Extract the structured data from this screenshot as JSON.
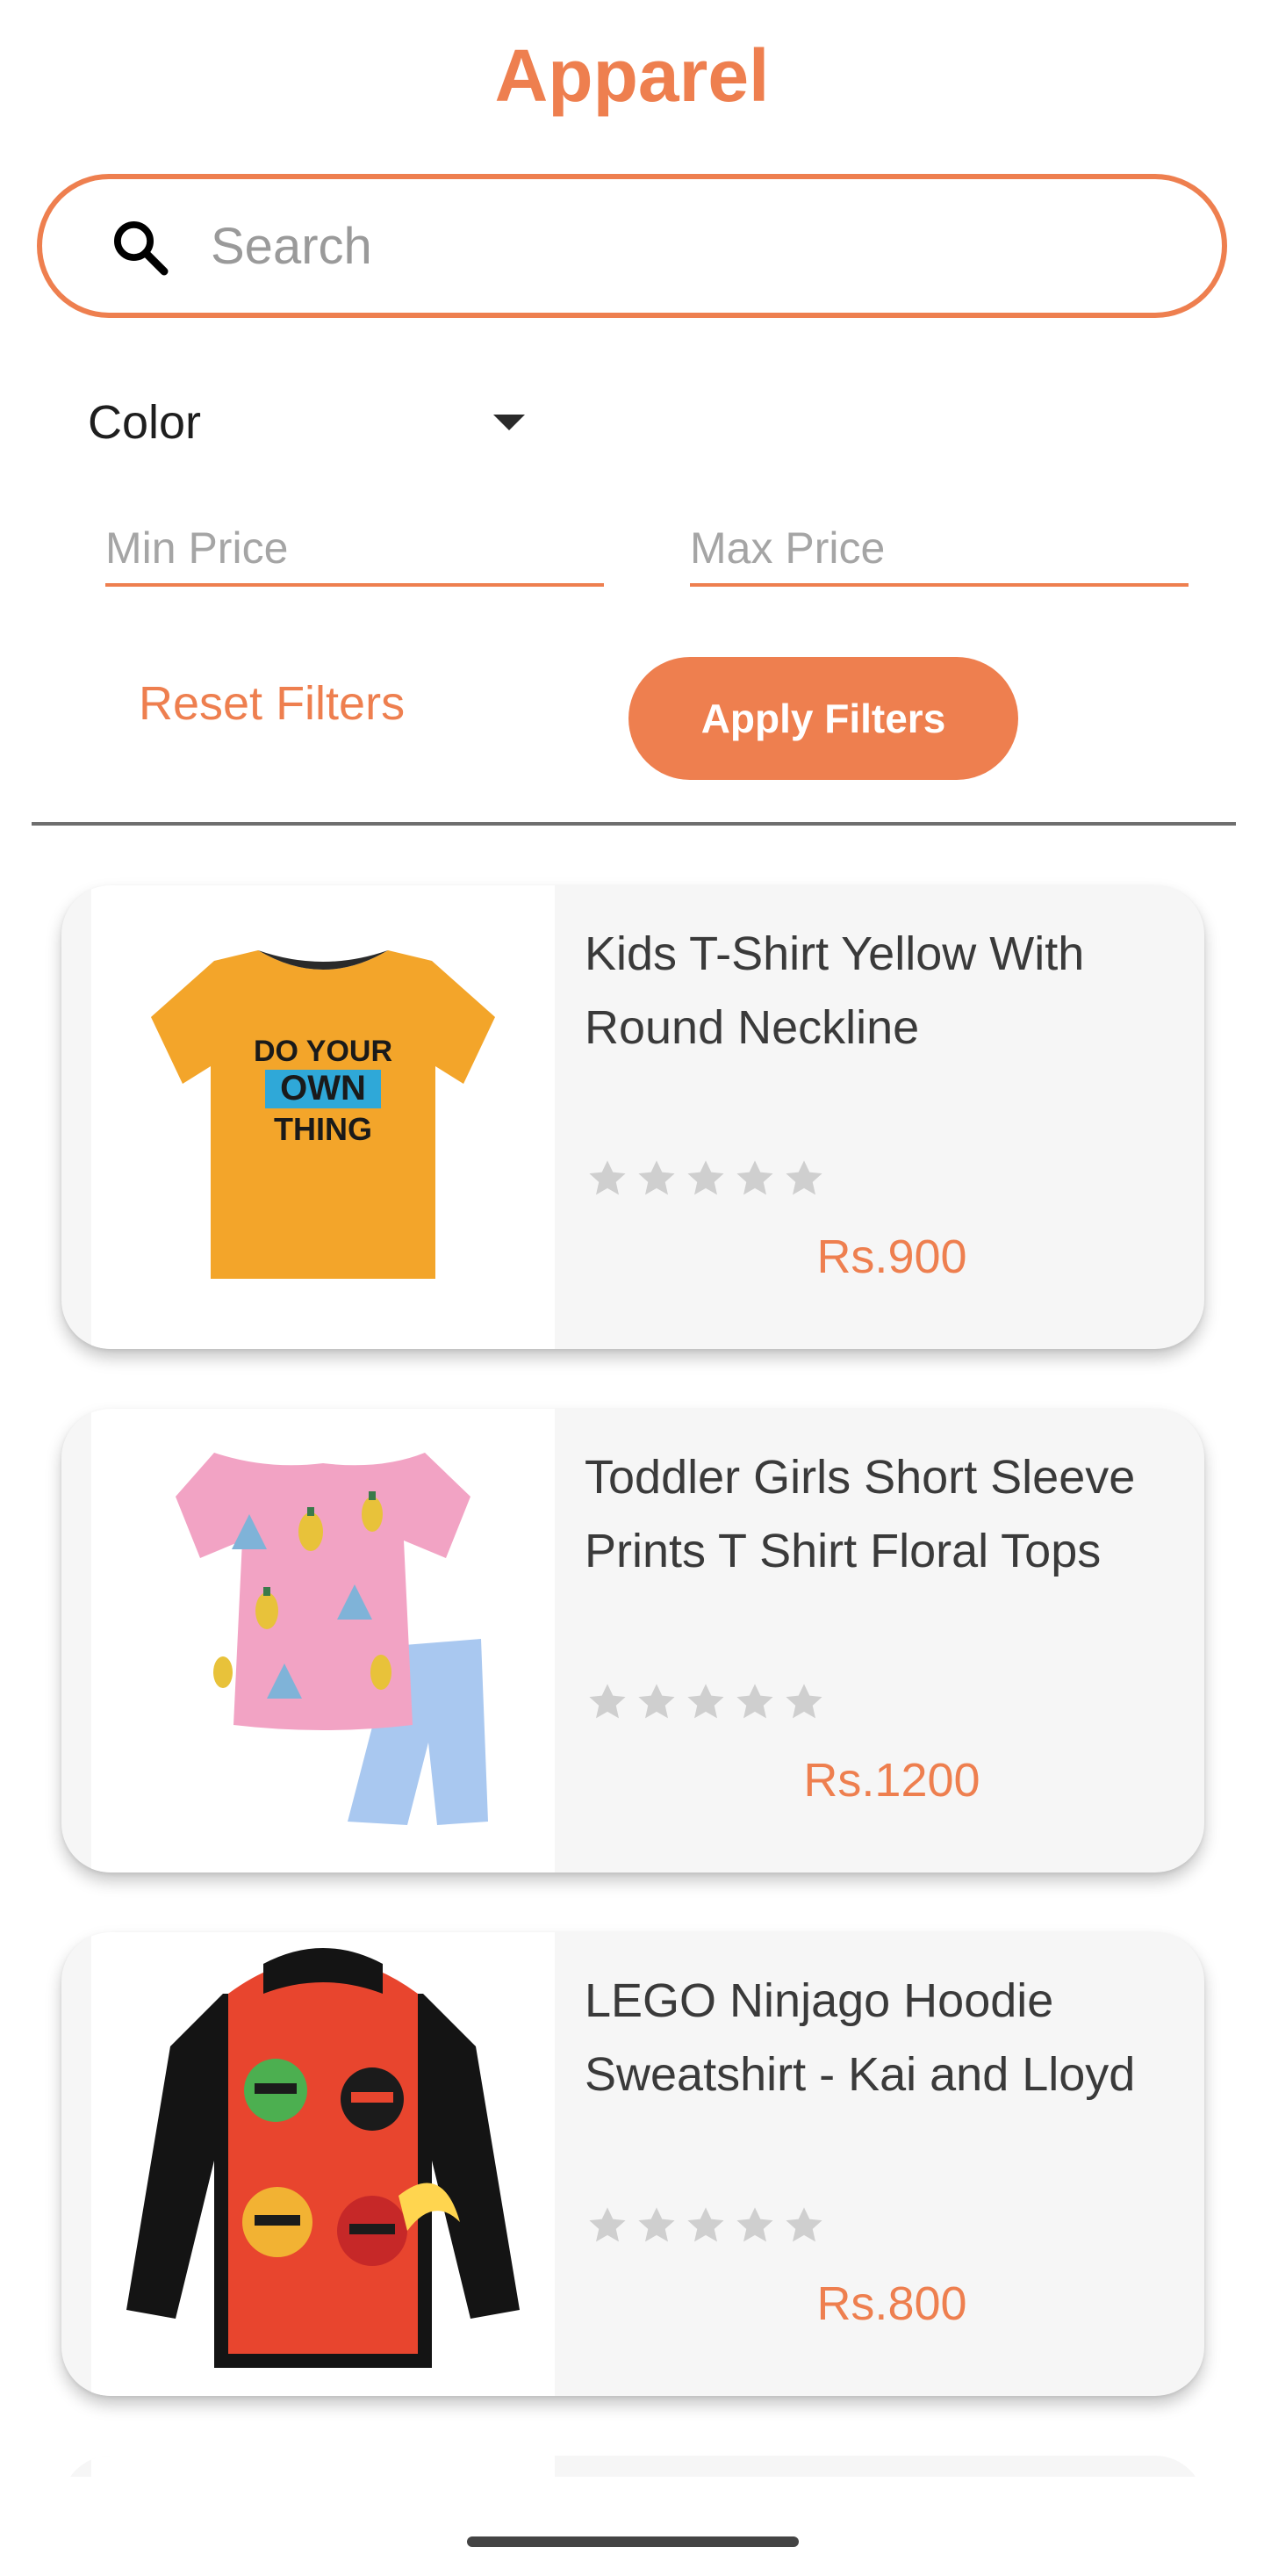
{
  "header": {
    "title": "Apparel"
  },
  "search": {
    "placeholder": "Search",
    "value": ""
  },
  "filters": {
    "color_label": "Color",
    "min_price_placeholder": "Min Price",
    "max_price_placeholder": "Max Price",
    "reset_label": "Reset Filters",
    "apply_label": "Apply Filters"
  },
  "products": [
    {
      "title": "Kids T-Shirt Yellow With Round Neckline",
      "price": "Rs.900",
      "rating": 0,
      "image": "yellow-tshirt-image",
      "print_text": [
        "DO YOUR",
        "OWN",
        "THING"
      ]
    },
    {
      "title": "Toddler Girls Short Sleeve Prints T Shirt Floral Tops",
      "price": "Rs.1200",
      "rating": 0,
      "image": "floral-top-shorts-image"
    },
    {
      "title": "LEGO Ninjago Hoodie Sweatshirt - Kai and Lloyd",
      "price": "Rs.800",
      "rating": 0,
      "image": "ninjago-hoodie-image"
    }
  ],
  "colors": {
    "accent": "#EE7F4F",
    "star_empty": "#cfcfcf",
    "card_bg": "#f6f6f6"
  }
}
